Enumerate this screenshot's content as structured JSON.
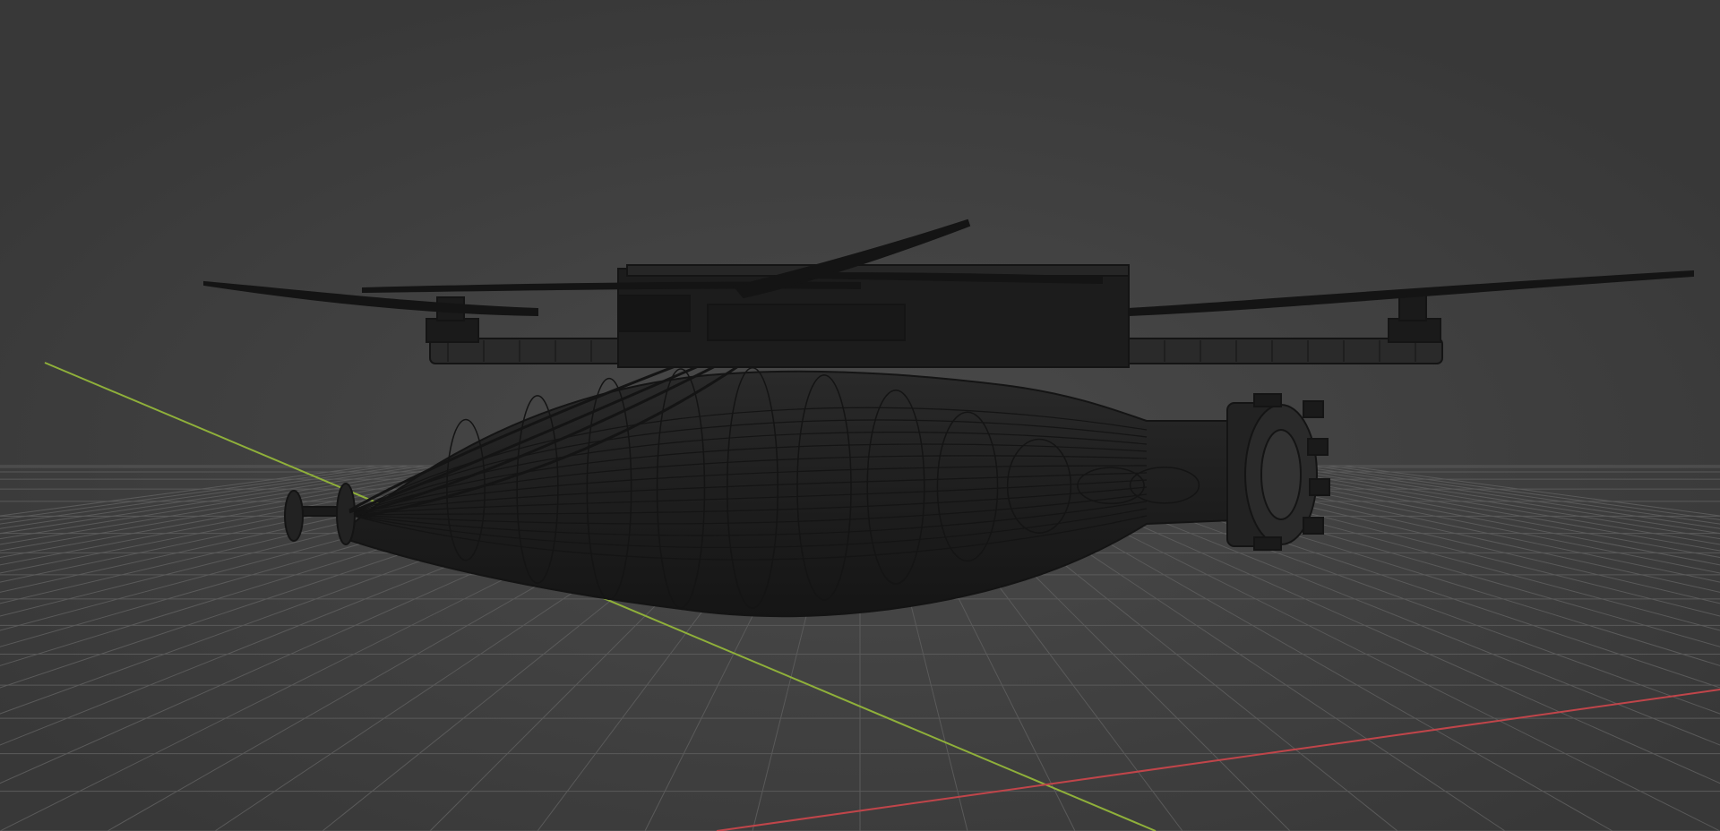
{
  "viewport": {
    "view_mode": "wireframe",
    "background_color": "#3d3d3d",
    "grid_color": "#5a5a5a",
    "x_axis_color": "#c0454a",
    "y_axis_color": "#8fb03a",
    "model_color": "#141414"
  },
  "model": {
    "components": [
      "drone-frame",
      "propeller",
      "motor",
      "payload-bomb",
      "tail-fins",
      "fuze",
      "cables"
    ]
  }
}
